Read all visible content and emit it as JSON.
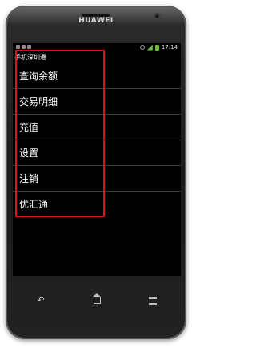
{
  "device": {
    "brand": "HUAWEI"
  },
  "status_bar": {
    "time": "17:14"
  },
  "app": {
    "title": "手机深圳通"
  },
  "menu": {
    "items": [
      {
        "label": "查询余额"
      },
      {
        "label": "交易明细"
      },
      {
        "label": "充值"
      },
      {
        "label": "设置"
      },
      {
        "label": "注销"
      },
      {
        "label": "优汇通"
      }
    ]
  },
  "colors": {
    "highlight": "#d6141e",
    "screen_bg": "#000000",
    "menu_text": "#ffffff"
  },
  "nav": {
    "back_icon": "back-arrow-icon",
    "home_icon": "home-icon",
    "menu_icon": "menu-icon"
  }
}
